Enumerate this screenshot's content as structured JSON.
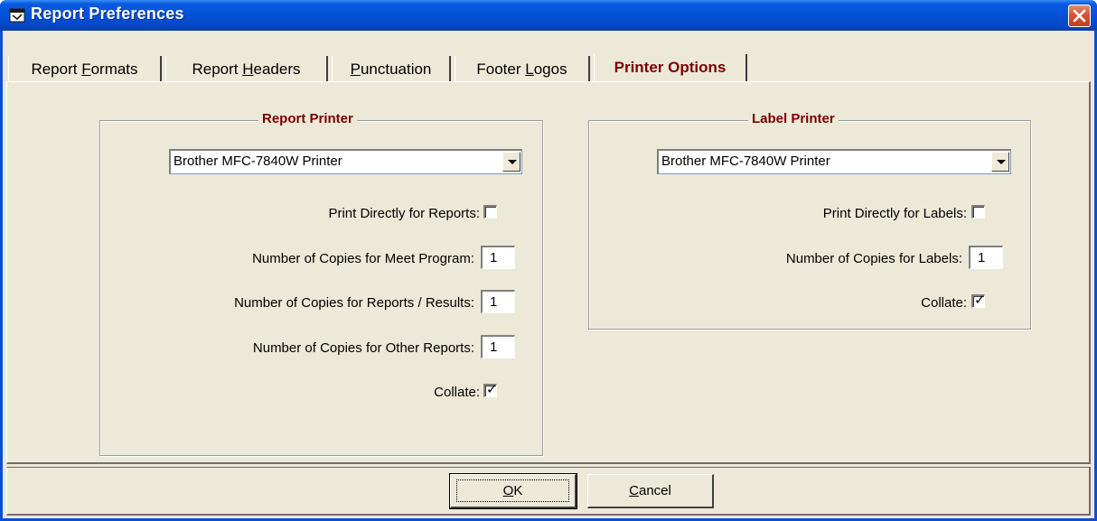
{
  "window": {
    "title": "Report Preferences",
    "close_glyph": "✕"
  },
  "tabs": [
    {
      "prefix": "Report ",
      "accel": "F",
      "suffix": "ormats"
    },
    {
      "prefix": "Report ",
      "accel": "H",
      "suffix": "eaders"
    },
    {
      "prefix": "",
      "accel": "P",
      "suffix": "unctuation"
    },
    {
      "prefix": "Footer ",
      "accel": "L",
      "suffix": "ogos"
    },
    {
      "label": "Printer Options",
      "active": true
    }
  ],
  "report_printer": {
    "title": "Report Printer",
    "selected_printer": "Brother MFC-7840W Printer",
    "print_directly_label": "Print Directly for Reports:",
    "print_directly_checked": false,
    "meet_program_label": "Number of Copies for Meet Program:",
    "meet_program_value": "1",
    "reports_results_label": "Number of Copies for Reports / Results:",
    "reports_results_value": "1",
    "other_reports_label": "Number of Copies for Other Reports:",
    "other_reports_value": "1",
    "collate_label": "Collate:",
    "collate_checked": true
  },
  "label_printer": {
    "title": "Label Printer",
    "selected_printer": "Brother MFC-7840W Printer",
    "print_directly_label": "Print Directly for Labels:",
    "print_directly_checked": false,
    "copies_label": "Number of Copies for Labels:",
    "copies_value": "1",
    "collate_label": "Collate:",
    "collate_checked": true
  },
  "buttons": {
    "ok_accel": "O",
    "ok_rest": "K",
    "cancel_accel": "C",
    "cancel_rest": "ancel"
  },
  "check_glyph": "✓",
  "colors": {
    "title_blue": "#0552d6",
    "face": "#ece9d8",
    "group_title": "#7a0000",
    "close_red": "#d5543a"
  }
}
